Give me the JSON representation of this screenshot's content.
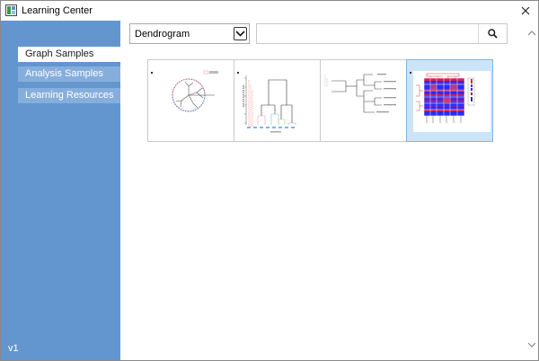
{
  "window": {
    "title": "Learning Center",
    "app_icon": "learning-center-icon",
    "close_icon": "close-icon"
  },
  "sidebar": {
    "items": [
      {
        "label": "Graph Samples",
        "active": true
      },
      {
        "label": "Analysis Samples",
        "active": false
      },
      {
        "label": "Learning Resources",
        "active": false
      }
    ],
    "version": "v1",
    "bg_color": "#6396cf",
    "item_bg_color": "#86aedc"
  },
  "toolbar": {
    "category_select": {
      "value": "Dendrogram",
      "icon": "chevron-down-icon"
    },
    "search": {
      "value": "",
      "placeholder": "",
      "icon": "search-icon"
    }
  },
  "gallery": {
    "thumbnails": [
      {
        "name": "circular-dendrogram",
        "selected": false
      },
      {
        "name": "vertical-dendrogram",
        "selected": false
      },
      {
        "name": "horizontal-dendrogram",
        "selected": false
      },
      {
        "name": "heatmap-dendrogram",
        "selected": true
      }
    ],
    "selected_bg_color": "#cce4f7"
  },
  "scrollbar": {
    "up_icon": "chevron-up-icon",
    "down_icon": "chevron-down-icon"
  }
}
